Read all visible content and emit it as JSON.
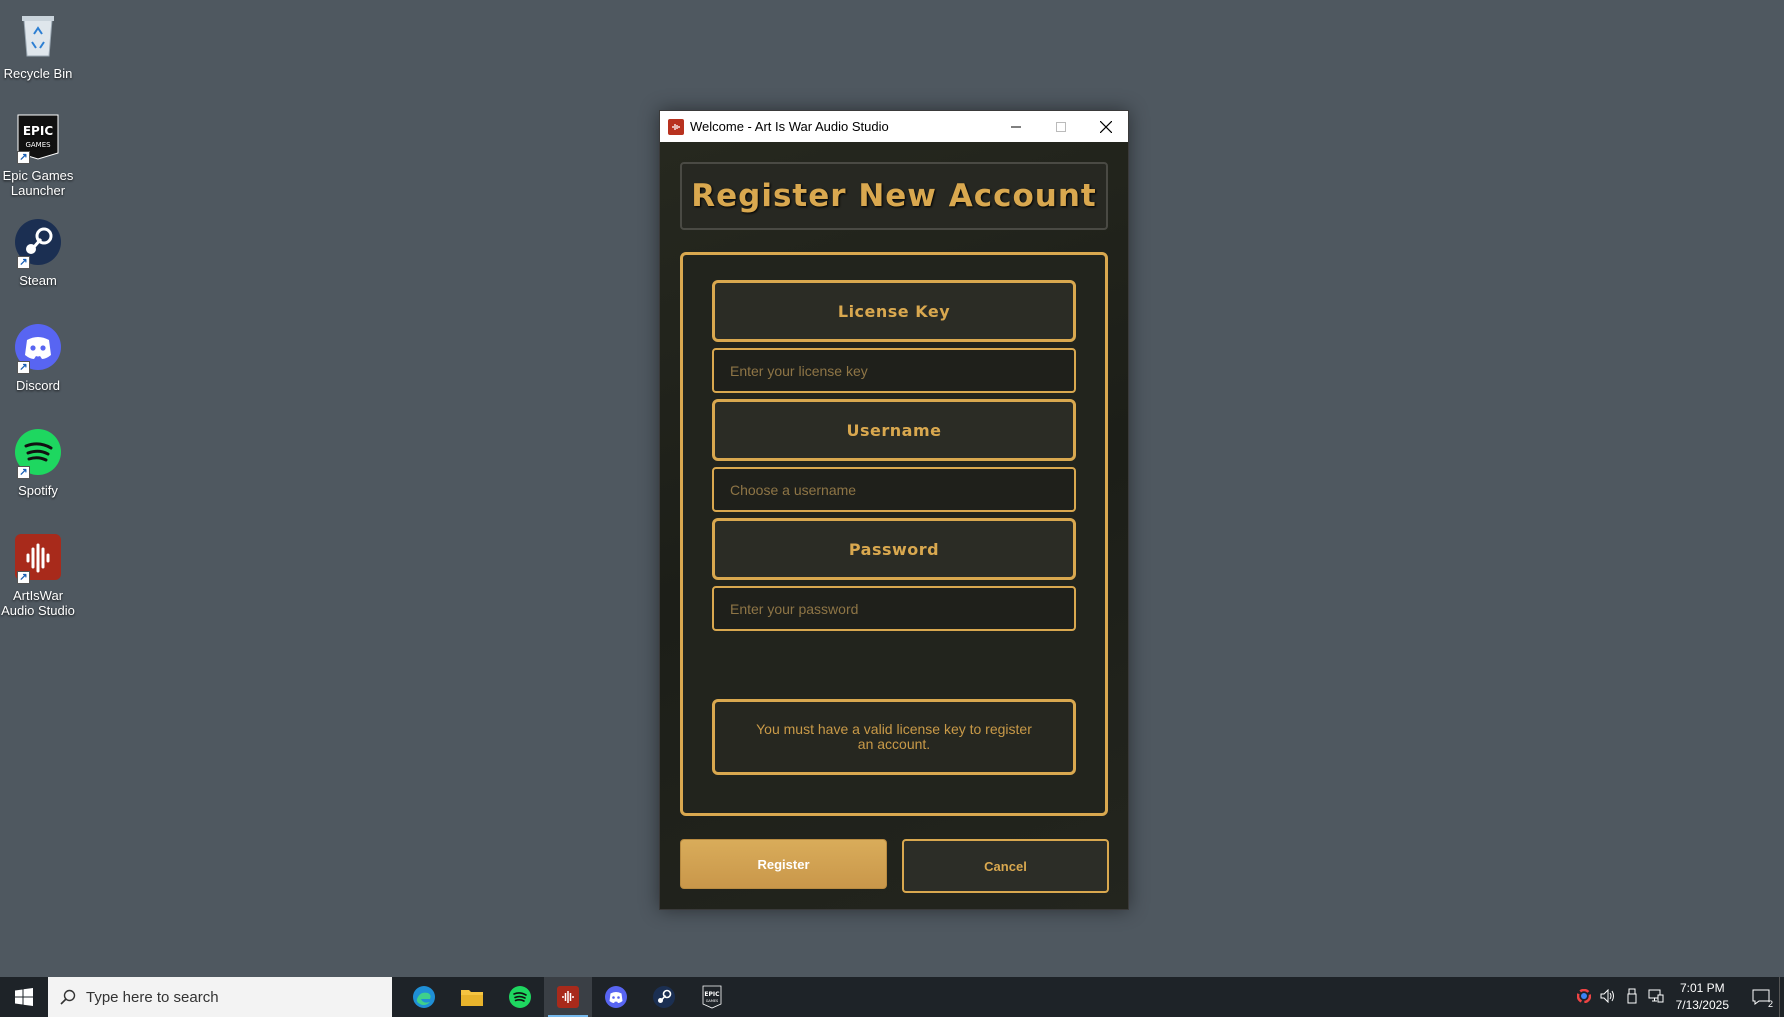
{
  "desktop": {
    "icons": [
      {
        "label": "Recycle Bin"
      },
      {
        "label": "Epic Games Launcher"
      },
      {
        "label": "Steam"
      },
      {
        "label": "Discord"
      },
      {
        "label": "Spotify"
      },
      {
        "label": "ArtIsWar Audio Studio"
      }
    ]
  },
  "window": {
    "title": "Welcome - Art Is War Audio Studio",
    "heading": "Register New Account",
    "license": {
      "label": "License Key",
      "placeholder": "Enter your license key"
    },
    "username": {
      "label": "Username",
      "placeholder": "Choose a username"
    },
    "password": {
      "label": "Password",
      "placeholder": "Enter your password"
    },
    "info": "You must have a valid license key to register an account.",
    "register_label": "Register",
    "cancel_label": "Cancel"
  },
  "taskbar": {
    "search_placeholder": "Type here to search",
    "time": "7:01 PM",
    "date": "7/13/2025",
    "notification_count": "2"
  },
  "colors": {
    "accent": "#d9a84f",
    "desktop": "#4f5860",
    "window_bg": "#1e201a"
  }
}
